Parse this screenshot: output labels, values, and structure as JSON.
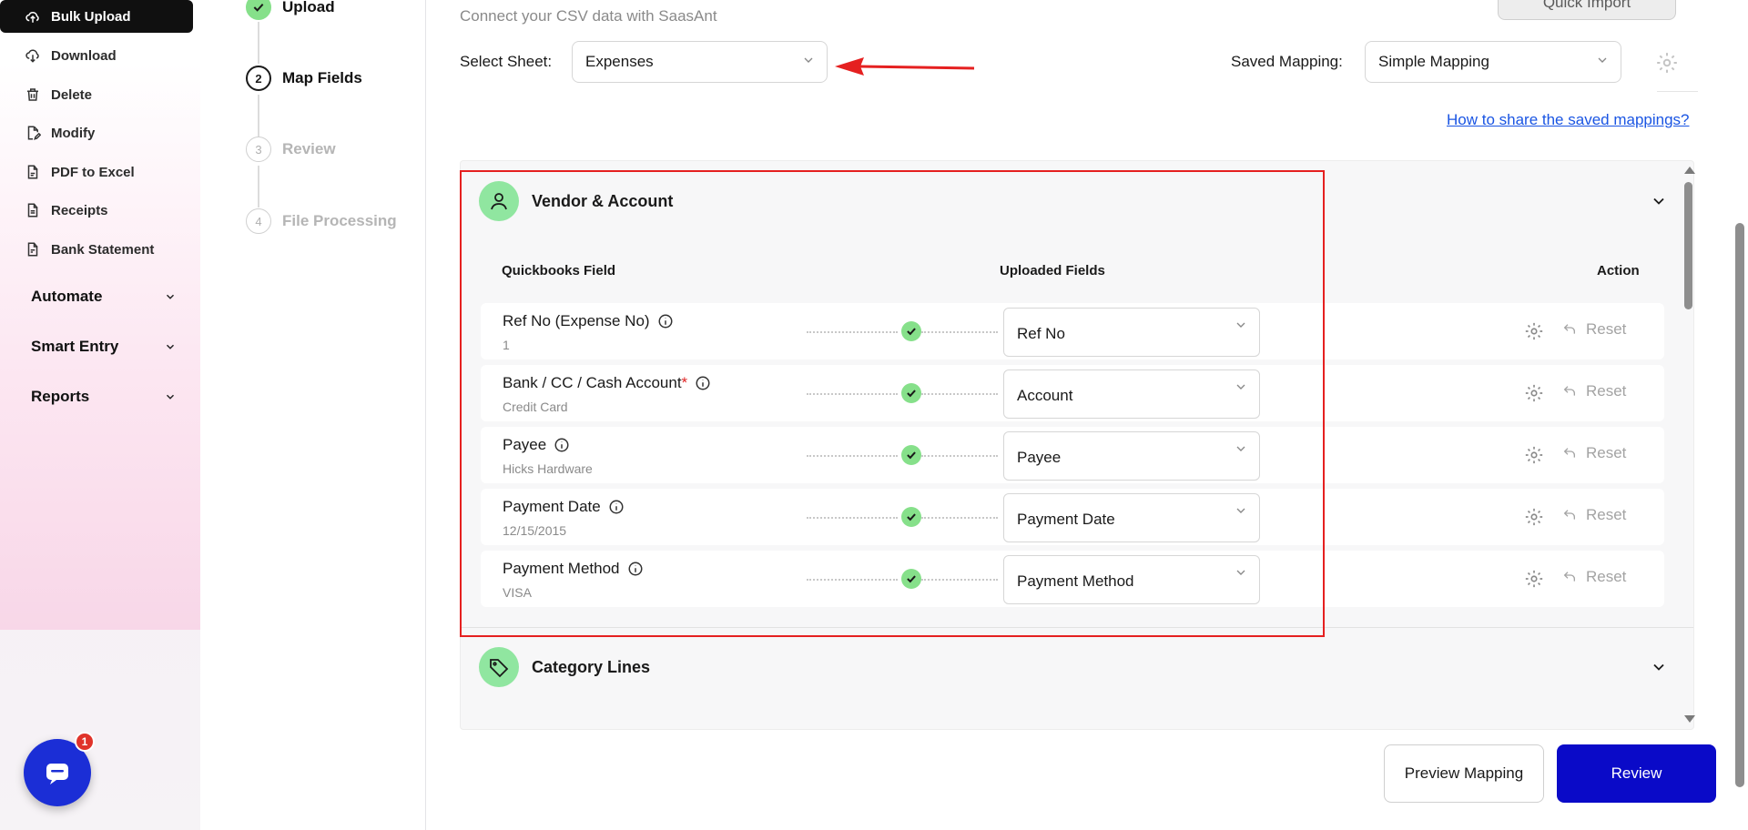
{
  "sidebar": {
    "items": [
      {
        "label": "Bulk Upload",
        "icon": "upload-cloud-icon"
      },
      {
        "label": "Download",
        "icon": "download-cloud-icon"
      },
      {
        "label": "Delete",
        "icon": "trash-icon"
      },
      {
        "label": "Modify",
        "icon": "edit-file-icon"
      },
      {
        "label": "PDF to Excel",
        "icon": "pdf-file-icon"
      },
      {
        "label": "Receipts",
        "icon": "receipt-file-icon"
      },
      {
        "label": "Bank Statement",
        "icon": "bank-file-icon"
      }
    ],
    "groups": [
      {
        "label": "Automate"
      },
      {
        "label": "Smart Entry"
      },
      {
        "label": "Reports"
      }
    ],
    "chat_badge": "1"
  },
  "stepper": {
    "steps": [
      {
        "number": "",
        "label": "Upload",
        "state": "done"
      },
      {
        "number": "2",
        "label": "Map Fields",
        "state": "current"
      },
      {
        "number": "3",
        "label": "Review",
        "state": "todo"
      },
      {
        "number": "4",
        "label": "File Processing",
        "state": "todo"
      }
    ]
  },
  "header": {
    "subtitle": "Connect your CSV data with SaasAnt",
    "quick_import_label": "Quick Import",
    "select_sheet_label": "Select Sheet:",
    "select_sheet_value": "Expenses",
    "saved_mapping_label": "Saved Mapping:",
    "saved_mapping_value": "Simple Mapping",
    "share_link": "How to share the saved mappings?"
  },
  "sections": {
    "vendor": {
      "title": "Vendor & Account",
      "col_qb": "Quickbooks Field",
      "col_uploaded": "Uploaded Fields",
      "col_action": "Action",
      "rows": [
        {
          "field": "Ref No (Expense No)",
          "required": "",
          "sample": "1",
          "mapped": "Ref No",
          "reset": "Reset"
        },
        {
          "field": "Bank / CC / Cash Account",
          "required": "*",
          "sample": "Credit Card",
          "mapped": "Account",
          "reset": "Reset"
        },
        {
          "field": "Payee",
          "required": "",
          "sample": "Hicks Hardware",
          "mapped": "Payee",
          "reset": "Reset"
        },
        {
          "field": "Payment Date",
          "required": "",
          "sample": "12/15/2015",
          "mapped": "Payment Date",
          "reset": "Reset"
        },
        {
          "field": "Payment Method",
          "required": "",
          "sample": "VISA",
          "mapped": "Payment Method",
          "reset": "Reset"
        }
      ]
    },
    "category": {
      "title": "Category Lines"
    }
  },
  "footer": {
    "preview_label": "Preview Mapping",
    "review_label": "Review"
  },
  "colors": {
    "accent": "#0a0ac8",
    "success": "#86e08a",
    "highlight": "#e52020",
    "link": "#1a55e3"
  }
}
